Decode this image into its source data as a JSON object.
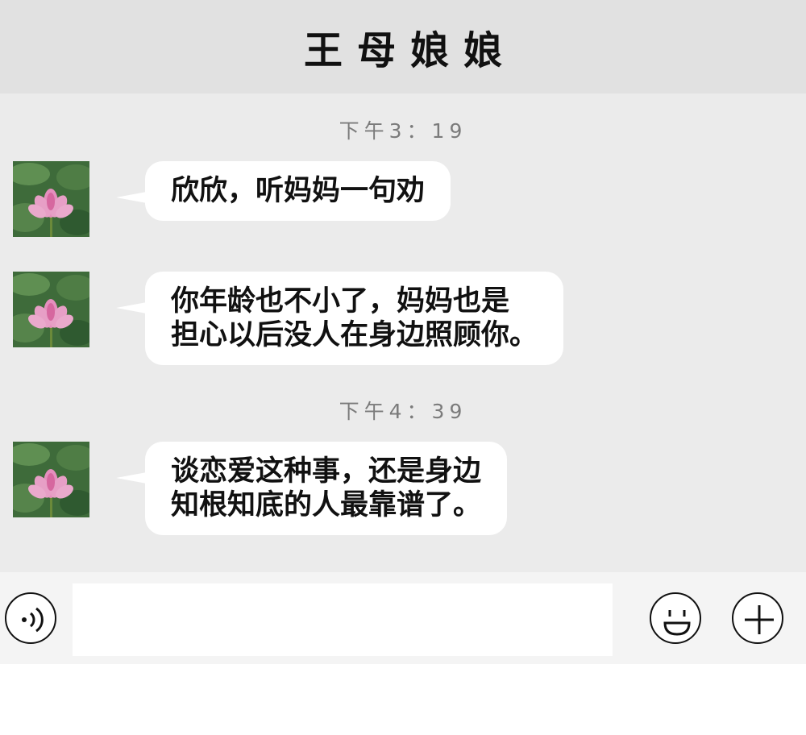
{
  "header": {
    "title": "王母娘娘"
  },
  "chat": {
    "groups": [
      {
        "time": "下午3：19"
      },
      {
        "time": "下午4：39"
      }
    ],
    "messages": [
      {
        "sender_avatar": "lotus-avatar",
        "text": "欣欣，听妈妈一句劝"
      },
      {
        "sender_avatar": "lotus-avatar",
        "text": "你年龄也不小了，妈妈也是\n担心以后没人在身边照顾你。"
      },
      {
        "sender_avatar": "lotus-avatar",
        "text": "谈恋爱这种事，还是身边\n知根知底的人最靠谱了。"
      }
    ]
  },
  "input_bar": {
    "voice_icon": "voice-icon",
    "message_value": "",
    "emoji_icon": "emoji-icon",
    "plus_icon": "plus-icon"
  },
  "colors": {
    "header_bg": "#e1e1e1",
    "chat_bg": "#ebebeb",
    "bubble_bg": "#ffffff",
    "timestamp_text": "#7b7b7b"
  }
}
